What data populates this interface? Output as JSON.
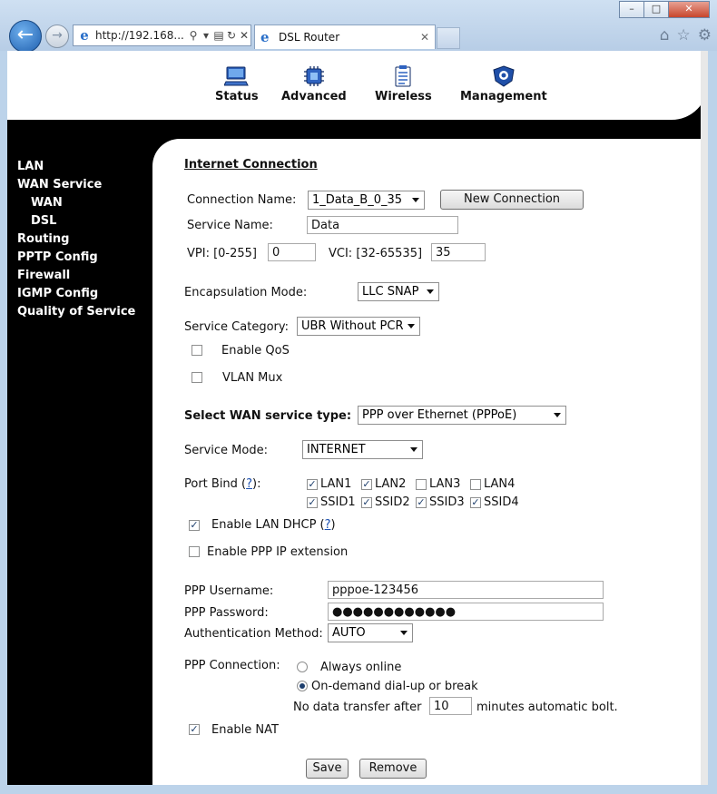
{
  "browser": {
    "url": "http://192.168...",
    "tab_title": "DSL Router",
    "window_buttons": {
      "minimize": "–",
      "maximize": "□",
      "close": "✕"
    }
  },
  "topnav": {
    "items": [
      {
        "label": "Status",
        "icon": "monitor-icon"
      },
      {
        "label": "Advanced",
        "icon": "chip-icon"
      },
      {
        "label": "Wireless",
        "icon": "clipboard-icon"
      },
      {
        "label": "Management",
        "icon": "shield-icon"
      }
    ]
  },
  "sidebar": {
    "items": [
      "LAN",
      "WAN Service",
      "WAN",
      "DSL",
      "Routing",
      "PPTP Config",
      "Firewall",
      "IGMP Config",
      "Quality of Service"
    ]
  },
  "form": {
    "heading": "Internet Connection",
    "connection_name_label": "Connection Name:",
    "connection_name_value": "1_Data_B_0_35",
    "new_connection_button": "New Connection",
    "service_name_label": "Service Name:",
    "service_name_value": "Data",
    "vpi_label": "VPI: [0-255]",
    "vpi_value": "0",
    "vci_label": "VCI: [32-65535]",
    "vci_value": "35",
    "encapsulation_label": "Encapsulation Mode:",
    "encapsulation_value": "LLC SNAP",
    "service_category_label": "Service Category:",
    "service_category_value": "UBR Without PCR",
    "enable_qos_label": "Enable QoS",
    "enable_qos_checked": false,
    "vlan_mux_label": "VLAN Mux",
    "vlan_mux_checked": false,
    "wan_type_label": "Select WAN service type:",
    "wan_type_value": "PPP over Ethernet (PPPoE)",
    "service_mode_label": "Service Mode:",
    "service_mode_value": "INTERNET",
    "port_bind_label": "Port Bind (",
    "port_bind_help": "?",
    "port_bind_suffix": "):",
    "ports": [
      {
        "label": "LAN1",
        "checked": true
      },
      {
        "label": "LAN2",
        "checked": true
      },
      {
        "label": "LAN3",
        "checked": false
      },
      {
        "label": "LAN4",
        "checked": false
      },
      {
        "label": "SSID1",
        "checked": true
      },
      {
        "label": "SSID2",
        "checked": true
      },
      {
        "label": "SSID3",
        "checked": true
      },
      {
        "label": "SSID4",
        "checked": true
      }
    ],
    "lan_dhcp_label": "Enable LAN DHCP (",
    "lan_dhcp_help": "?",
    "lan_dhcp_suffix": ")",
    "lan_dhcp_checked": true,
    "ppp_ip_ext_label": "Enable PPP IP extension",
    "ppp_ip_ext_checked": false,
    "ppp_username_label": "PPP Username:",
    "ppp_username_value": "pppoe-123456",
    "ppp_password_label": "PPP Password:",
    "ppp_password_value": "●●●●●●●●●●●●",
    "auth_method_label": "Authentication Method:",
    "auth_method_value": "AUTO",
    "ppp_connection_label": "PPP Connection:",
    "always_online_label": "Always online",
    "on_demand_label": "On-demand dial-up or break",
    "idle_prefix": "No data transfer after",
    "idle_value": "10",
    "idle_suffix": "minutes automatic bolt.",
    "enable_nat_label": "Enable NAT",
    "enable_nat_checked": true,
    "save_button": "Save",
    "remove_button": "Remove"
  }
}
